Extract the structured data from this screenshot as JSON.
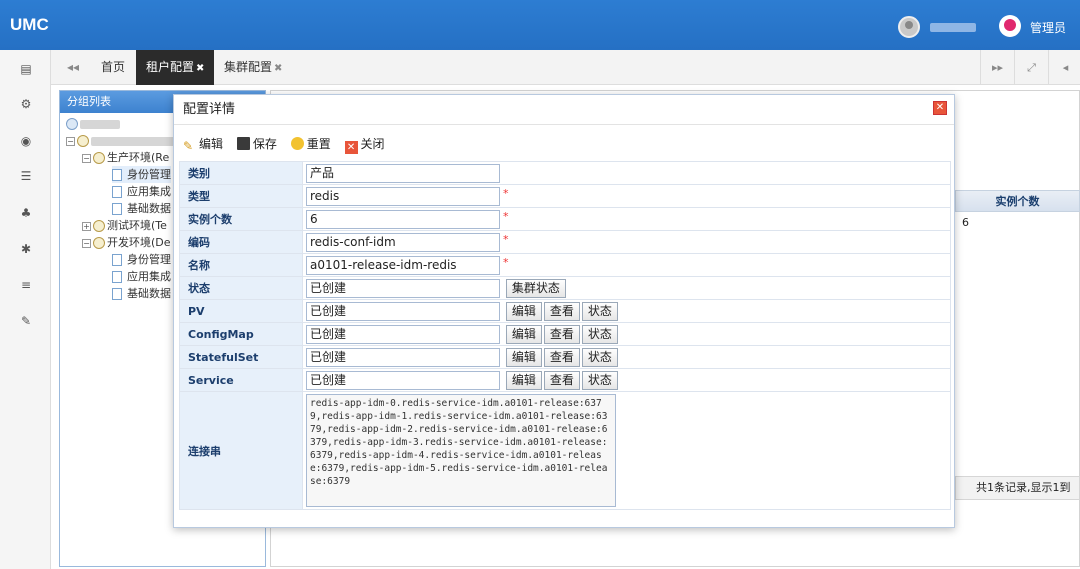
{
  "app": {
    "title": "UMC",
    "role": "管理员"
  },
  "tabs": {
    "home": "首页",
    "tenant": "租户配置",
    "cluster": "集群配置"
  },
  "group_panel": {
    "title": "分组列表",
    "nodes": [
      "生产环境(Re",
      "身份管理",
      "应用集成",
      "基础数据",
      "测试环境(Te",
      "开发环境(De",
      "身份管理",
      "应用集成",
      "基础数据"
    ]
  },
  "grid": {
    "col_instances": "实例个数",
    "cell_instances": "6",
    "pager": "共1条记录,显示1到"
  },
  "dialog": {
    "title": "配置详情",
    "toolbar": {
      "edit": "编辑",
      "save": "保存",
      "reset": "重置",
      "close": "关闭"
    },
    "fields": {
      "category": {
        "label": "类别",
        "value": "产品"
      },
      "type": {
        "label": "类型",
        "value": "redis"
      },
      "instances": {
        "label": "实例个数",
        "value": "6"
      },
      "code": {
        "label": "编码",
        "value": "redis-conf-idm"
      },
      "name": {
        "label": "名称",
        "value": "a0101-release-idm-redis"
      },
      "status": {
        "label": "状态",
        "value": "已创建",
        "button": "集群状态"
      },
      "pv": {
        "label": "PV",
        "value": "已创建"
      },
      "configmap": {
        "label": "ConfigMap",
        "value": "已创建"
      },
      "statefulset": {
        "label": "StatefulSet",
        "value": "已创建"
      },
      "service": {
        "label": "Service",
        "value": "已创建"
      },
      "conn": {
        "label": "连接串",
        "value": "redis-app-idm-0.redis-service-idm.a0101-release:6379,redis-app-idm-1.redis-service-idm.a0101-release:6379,redis-app-idm-2.redis-service-idm.a0101-release:6379,redis-app-idm-3.redis-service-idm.a0101-release:6379,redis-app-idm-4.redis-service-idm.a0101-release:6379,redis-app-idm-5.redis-service-idm.a0101-release:6379"
      }
    },
    "row_buttons": {
      "edit": "编辑",
      "view": "查看",
      "status": "状态"
    },
    "required_mark": "*"
  }
}
